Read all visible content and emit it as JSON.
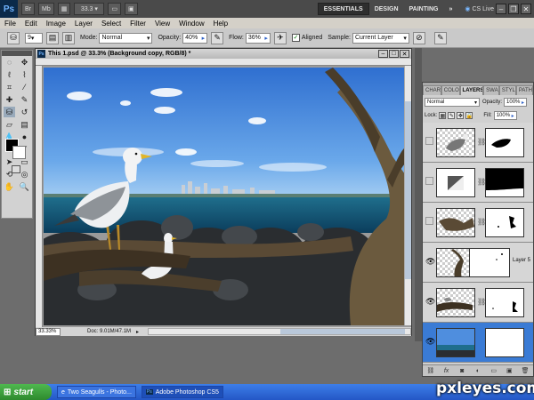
{
  "app": {
    "logo": "Ps",
    "zoom": "33.3",
    "workspaces": [
      "ESSENTIALS",
      "DESIGN",
      "PAINTING"
    ],
    "more": "»",
    "cs_live": "CS Live"
  },
  "menu": [
    "File",
    "Edit",
    "Image",
    "Layer",
    "Select",
    "Filter",
    "View",
    "Window",
    "Help"
  ],
  "options": {
    "brush_size": "9",
    "mode_label": "Mode:",
    "mode": "Normal",
    "opacity_label": "Opacity:",
    "opacity": "40%",
    "flow_label": "Flow:",
    "flow": "36%",
    "aligned_label": "Aligned",
    "sample_label": "Sample:",
    "sample": "Current Layer"
  },
  "document": {
    "title": "This 1.psd @ 33.3% (Background copy, RGB/8) *",
    "zoom": "33.33%",
    "doc_size": "Doc: 9.01M/47.1M"
  },
  "layers_panel": {
    "tabs": [
      "CHAR",
      "COLO",
      "LAYERS",
      "SWA",
      "STYL",
      "PATH"
    ],
    "active_tab": "LAYERS",
    "blend_mode": "Normal",
    "opacity_label": "Opacity:",
    "opacity": "100%",
    "lock_label": "Lock:",
    "fill_label": "Fill:",
    "fill": "100%",
    "layers": [
      {
        "name": "",
        "visible": false,
        "selected": false,
        "thumb": "seagull"
      },
      {
        "name": "",
        "visible": false,
        "selected": false,
        "thumb": "gradient"
      },
      {
        "name": "",
        "visible": false,
        "selected": false,
        "thumb": "branch"
      },
      {
        "name": "Layer 5",
        "visible": true,
        "selected": false,
        "thumb": "branch-tall"
      },
      {
        "name": "",
        "visible": true,
        "selected": false,
        "thumb": "branch-low"
      },
      {
        "name": "",
        "visible": true,
        "selected": true,
        "thumb": "sea"
      }
    ]
  },
  "taskbar": {
    "start": "start",
    "tasks": [
      {
        "label": "Two Seagulls - Photo...",
        "active": false
      },
      {
        "label": "Adobe Photoshop CS5",
        "active": true
      }
    ]
  },
  "watermark": "pxleyes.com",
  "colors": {
    "appbar": "#4a4a4a",
    "selection": "#3a7bd5",
    "taskbar": "#2457c6"
  }
}
